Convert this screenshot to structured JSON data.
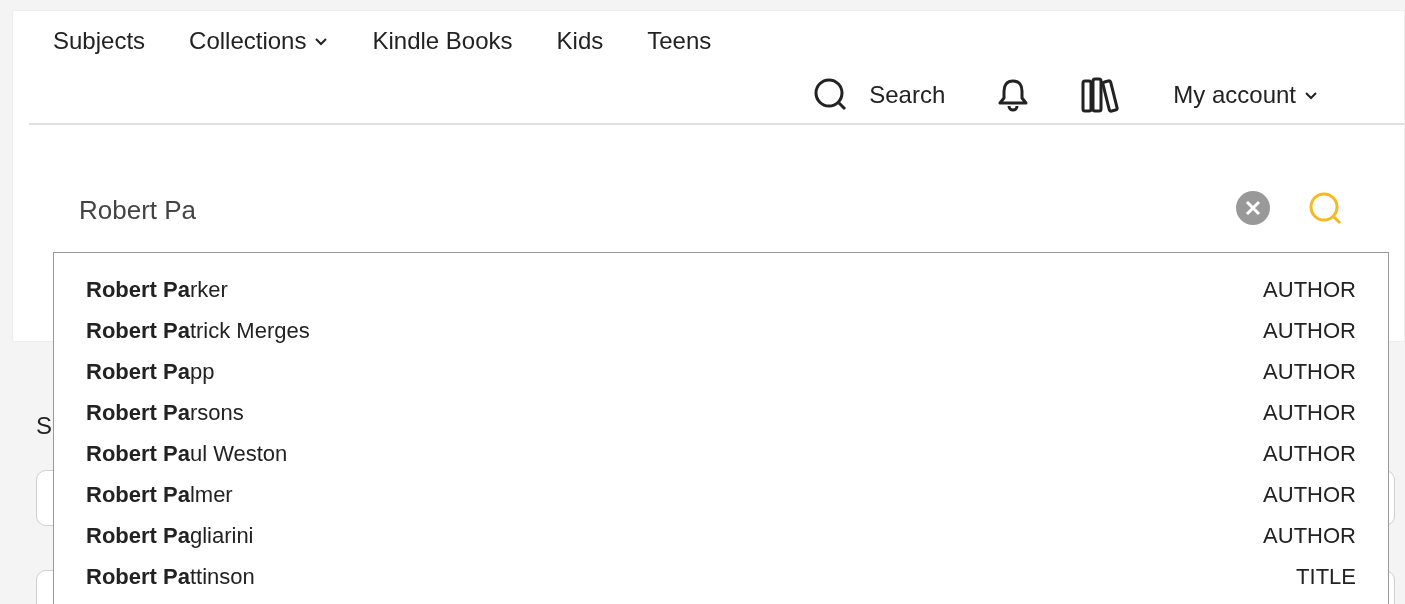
{
  "nav": {
    "links": [
      {
        "label": "Subjects",
        "dropdown": false
      },
      {
        "label": "Collections",
        "dropdown": true
      },
      {
        "label": "Kindle Books",
        "dropdown": false
      },
      {
        "label": "Kids",
        "dropdown": false
      },
      {
        "label": "Teens",
        "dropdown": false
      }
    ],
    "search_link": "Search",
    "account": "My account"
  },
  "search": {
    "value": "Robert Pa"
  },
  "behind": {
    "heading": "S"
  },
  "suggestions": [
    {
      "text": "**Robert Pa**rker",
      "type": "AUTHOR"
    },
    {
      "text": "**Robert Pa**trick Merges",
      "type": "AUTHOR"
    },
    {
      "text": "**Robert Pa**pp",
      "type": "AUTHOR"
    },
    {
      "text": "**Robert Pa**rsons",
      "type": "AUTHOR"
    },
    {
      "text": "**Robert Pa**ul Weston",
      "type": "AUTHOR"
    },
    {
      "text": "**Robert Pa**lmer",
      "type": "AUTHOR"
    },
    {
      "text": "**Robert Pa**gliarini",
      "type": "AUTHOR"
    },
    {
      "text": "**Robert Pa**ttinson",
      "type": "TITLE"
    }
  ]
}
